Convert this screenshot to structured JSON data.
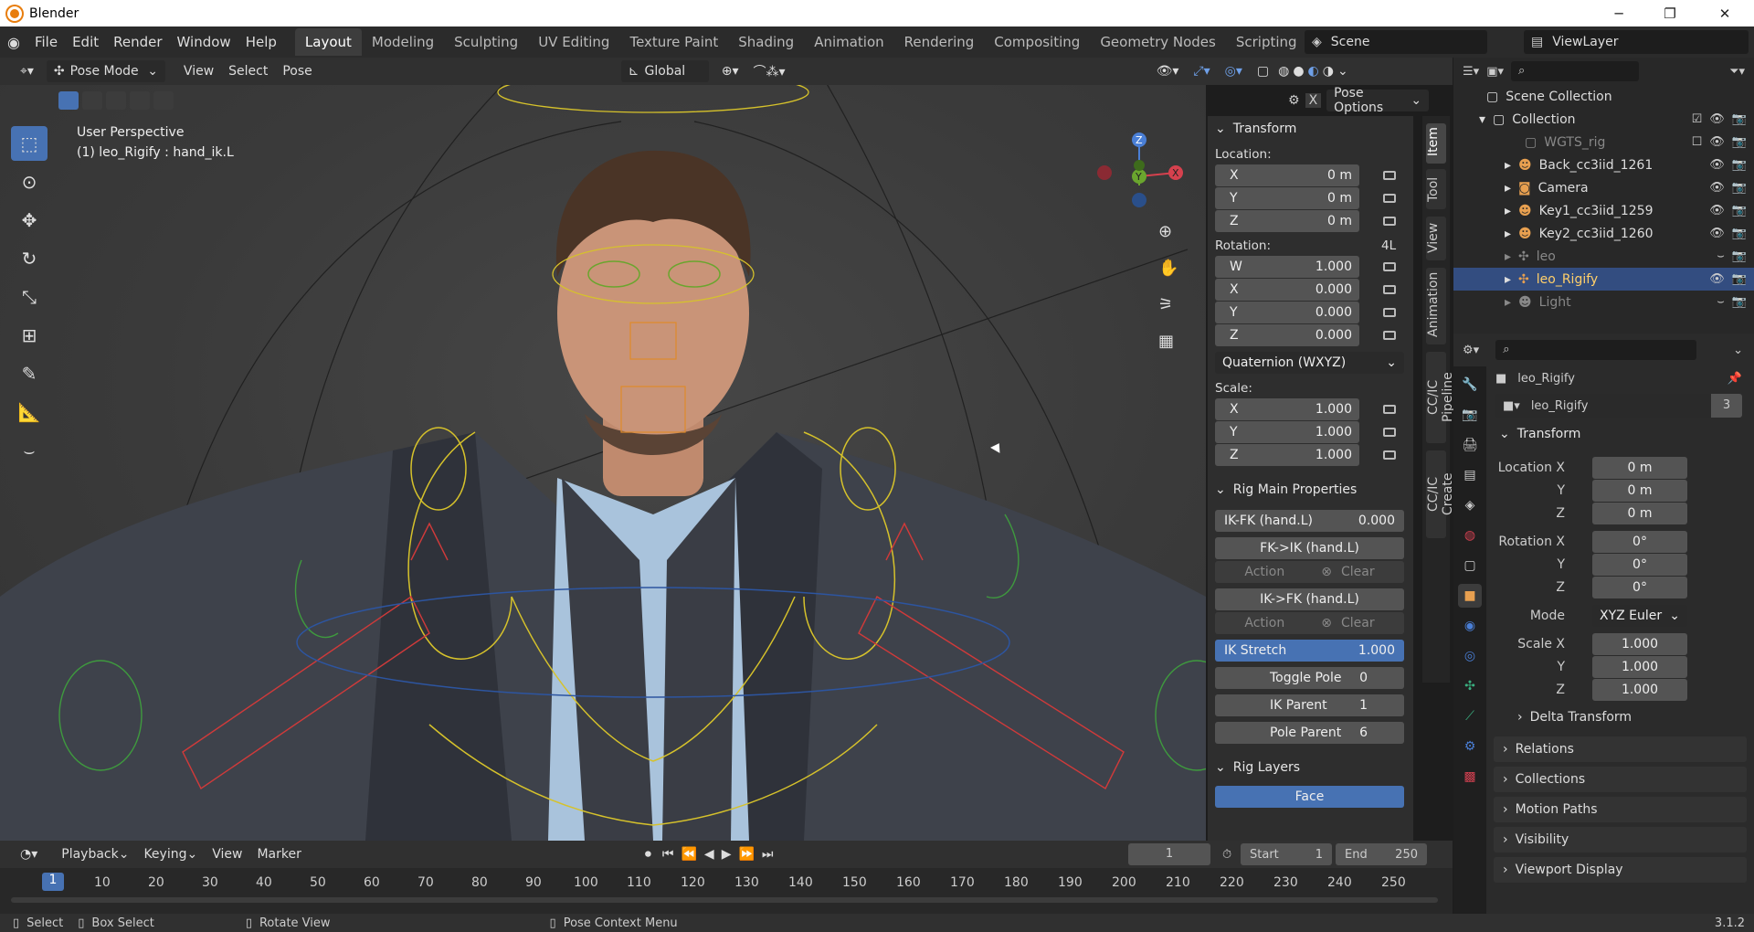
{
  "app": {
    "title": "Blender"
  },
  "menu": [
    "File",
    "Edit",
    "Render",
    "Window",
    "Help"
  ],
  "workspaces": [
    "Layout",
    "Modeling",
    "Sculpting",
    "UV Editing",
    "Texture Paint",
    "Shading",
    "Animation",
    "Rendering",
    "Compositing",
    "Geometry Nodes",
    "Scripting"
  ],
  "active_workspace": "Layout",
  "scene": "Scene",
  "view_layer": "ViewLayer",
  "viewport": {
    "mode": "Pose Mode",
    "menus": [
      "View",
      "Select",
      "Pose"
    ],
    "orientation": "Global",
    "pose_options": "Pose Options",
    "perspective": "User Perspective",
    "active": "(1) leo_Rigify : hand_ik.L"
  },
  "npanel": {
    "tabs": [
      "Item",
      "Tool",
      "View",
      "Animation",
      "CC/IC Pipeline",
      "CC/IC Create"
    ],
    "active_tab": "Item",
    "transform": {
      "title": "Transform",
      "location_label": "Location:",
      "location": [
        {
          "l": "X",
          "v": "0 m"
        },
        {
          "l": "Y",
          "v": "0 m"
        },
        {
          "l": "Z",
          "v": "0 m"
        }
      ],
      "rotation_label": "Rotation:",
      "rotation_tag": "4L",
      "rotation": [
        {
          "l": "W",
          "v": "1.000"
        },
        {
          "l": "X",
          "v": "0.000"
        },
        {
          "l": "Y",
          "v": "0.000"
        },
        {
          "l": "Z",
          "v": "0.000"
        }
      ],
      "rotation_mode": "Quaternion (WXYZ)",
      "scale_label": "Scale:",
      "scale": [
        {
          "l": "X",
          "v": "1.000"
        },
        {
          "l": "Y",
          "v": "1.000"
        },
        {
          "l": "Z",
          "v": "1.000"
        }
      ]
    },
    "rig_main": {
      "title": "Rig Main Properties",
      "ikfk_label": "IK-FK (hand.L)",
      "ikfk_value": "0.000",
      "fk_to_ik": "FK->IK (hand.L)",
      "ik_to_fk": "IK->FK (hand.L)",
      "action": "Action",
      "clear": "Clear",
      "ik_stretch_label": "IK Stretch",
      "ik_stretch_value": "1.000",
      "toggle_pole_label": "Toggle Pole",
      "toggle_pole_value": "0",
      "ik_parent_label": "IK Parent",
      "ik_parent_value": "1",
      "pole_parent_label": "Pole Parent",
      "pole_parent_value": "6"
    },
    "rig_layers": {
      "title": "Rig Layers",
      "first": "Face"
    }
  },
  "outliner": {
    "root": "Scene Collection",
    "collection": "Collection",
    "items": [
      {
        "name": "WGTS_rig",
        "dim": true
      },
      {
        "name": "Back_cc3iid_1261"
      },
      {
        "name": "Camera"
      },
      {
        "name": "Key1_cc3iid_1259"
      },
      {
        "name": "Key2_cc3iid_1260"
      },
      {
        "name": "leo",
        "dim": true
      },
      {
        "name": "leo_Rigify",
        "selected": true
      },
      {
        "name": "Light",
        "dim": true
      }
    ]
  },
  "properties": {
    "object_name": "leo_Rigify",
    "data_name": "leo_Rigify",
    "users": "3",
    "transform_title": "Transform",
    "loc": [
      {
        "l": "Location X",
        "v": "0 m"
      },
      {
        "l": "Y",
        "v": "0 m"
      },
      {
        "l": "Z",
        "v": "0 m"
      }
    ],
    "rot": [
      {
        "l": "Rotation X",
        "v": "0°"
      },
      {
        "l": "Y",
        "v": "0°"
      },
      {
        "l": "Z",
        "v": "0°"
      }
    ],
    "mode_label": "Mode",
    "mode": "XYZ Euler",
    "scale": [
      {
        "l": "Scale X",
        "v": "1.000"
      },
      {
        "l": "Y",
        "v": "1.000"
      },
      {
        "l": "Z",
        "v": "1.000"
      }
    ],
    "delta": "Delta Transform",
    "sections": [
      "Relations",
      "Collections",
      "Motion Paths",
      "Visibility",
      "Viewport Display"
    ]
  },
  "timeline": {
    "menus": [
      "Playback",
      "Keying",
      "View",
      "Marker"
    ],
    "current_frame": "1",
    "start_label": "Start",
    "start": "1",
    "end_label": "End",
    "end": "250",
    "ticks": [
      "1",
      "10",
      "20",
      "30",
      "40",
      "50",
      "60",
      "70",
      "80",
      "90",
      "100",
      "110",
      "120",
      "130",
      "140",
      "150",
      "160",
      "170",
      "180",
      "190",
      "200",
      "210",
      "220",
      "230",
      "240",
      "250"
    ]
  },
  "status": {
    "select": "Select",
    "box_select": "Box Select",
    "rotate": "Rotate View",
    "context": "Pose Context Menu",
    "version": "3.1.2"
  }
}
